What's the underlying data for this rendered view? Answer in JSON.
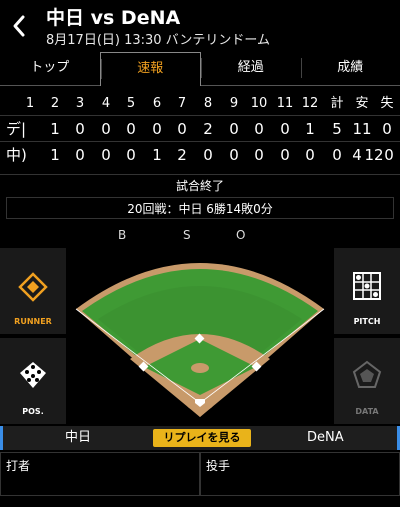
{
  "header": {
    "title": "中日 vs DeNA",
    "subtitle": "8月17日(日) 13:30 バンテリンドーム"
  },
  "tabs": [
    {
      "label": "トップ"
    },
    {
      "label": "速報"
    },
    {
      "label": "経過"
    },
    {
      "label": "成績"
    }
  ],
  "scoreboard": {
    "innings": [
      "1",
      "2",
      "3",
      "4",
      "5",
      "6",
      "7",
      "8",
      "9",
      "10",
      "11",
      "12"
    ],
    "totals_headers": [
      "計",
      "安",
      "失"
    ],
    "rows": [
      {
        "team": "デ|",
        "runs": [
          "1",
          "0",
          "0",
          "0",
          "0",
          "0",
          "2",
          "0",
          "0",
          "0",
          "1"
        ],
        "extra": "5",
        "hits": "11",
        "errors": "0"
      },
      {
        "team": "中)",
        "runs": [
          "1",
          "0",
          "0",
          "0",
          "1",
          "2",
          "0",
          "0",
          "0",
          "0",
          "0"
        ],
        "extra": "0",
        "hits": "4",
        "errors": "12"
      }
    ]
  },
  "scoreboard_display": {
    "row0": [
      "1",
      "0",
      "0",
      "0",
      "0",
      "0",
      "2",
      "0",
      "0",
      "0",
      "1",
      "5",
      "11",
      "0"
    ],
    "row1": [
      "1",
      "0",
      "0",
      "0",
      "1",
      "2",
      "0",
      "0",
      "0",
      "0",
      "0",
      "0",
      "4",
      "12",
      "0"
    ]
  },
  "status": "試合終了",
  "series": "20回戦：中日 6勝14敗0分",
  "bso": {
    "b": "B",
    "s": "S",
    "o": "O"
  },
  "side_buttons": {
    "runner": "RUNNER",
    "pitch": "PITCH",
    "pos": "POS.",
    "data": "DATA"
  },
  "teambar": {
    "left": "中日",
    "replay": "リプレイを見る",
    "right": "DeNA"
  },
  "bottom": {
    "batter": "打者",
    "pitcher": "投手"
  },
  "colors": {
    "accent": "#f0a020",
    "replay": "#e9b31a",
    "field_grass": "#3f9a34",
    "dirt": "#c89a6a",
    "team_bar_edge": "#3a8ee8"
  }
}
